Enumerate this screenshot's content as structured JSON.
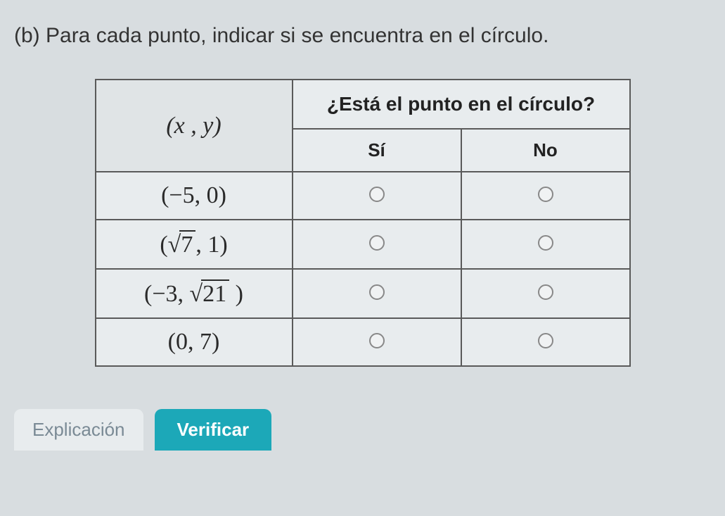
{
  "prompt": "(b) Para cada punto, indicar si se encuentra en el círculo.",
  "header": {
    "xy": "(x , y)",
    "question": "¿Está el punto en el círculo?",
    "yes": "Sí",
    "no": "No"
  },
  "rows": [
    {
      "point_plain": "(−5, 0)",
      "point_html": "(−5, 0)"
    },
    {
      "point_plain": "(√7, 1)",
      "point_html": "(<span class='sqrt'><span class='sqrt-body'>7</span></span>, 1)"
    },
    {
      "point_plain": "(−3, √21)",
      "point_html": "(−3, <span class='sqrt'><span class='sqrt-body'>21</span></span> )"
    },
    {
      "point_plain": "(0, 7)",
      "point_html": "(0, 7)"
    }
  ],
  "buttons": {
    "explain": "Explicación",
    "verify": "Verificar"
  },
  "chart_data": {
    "type": "table",
    "title": "¿Está el punto en el círculo?",
    "columns": [
      "(x, y)",
      "Sí",
      "No"
    ],
    "points": [
      "(-5, 0)",
      "(√7, 1)",
      "(-3, √21)",
      "(0, 7)"
    ]
  }
}
